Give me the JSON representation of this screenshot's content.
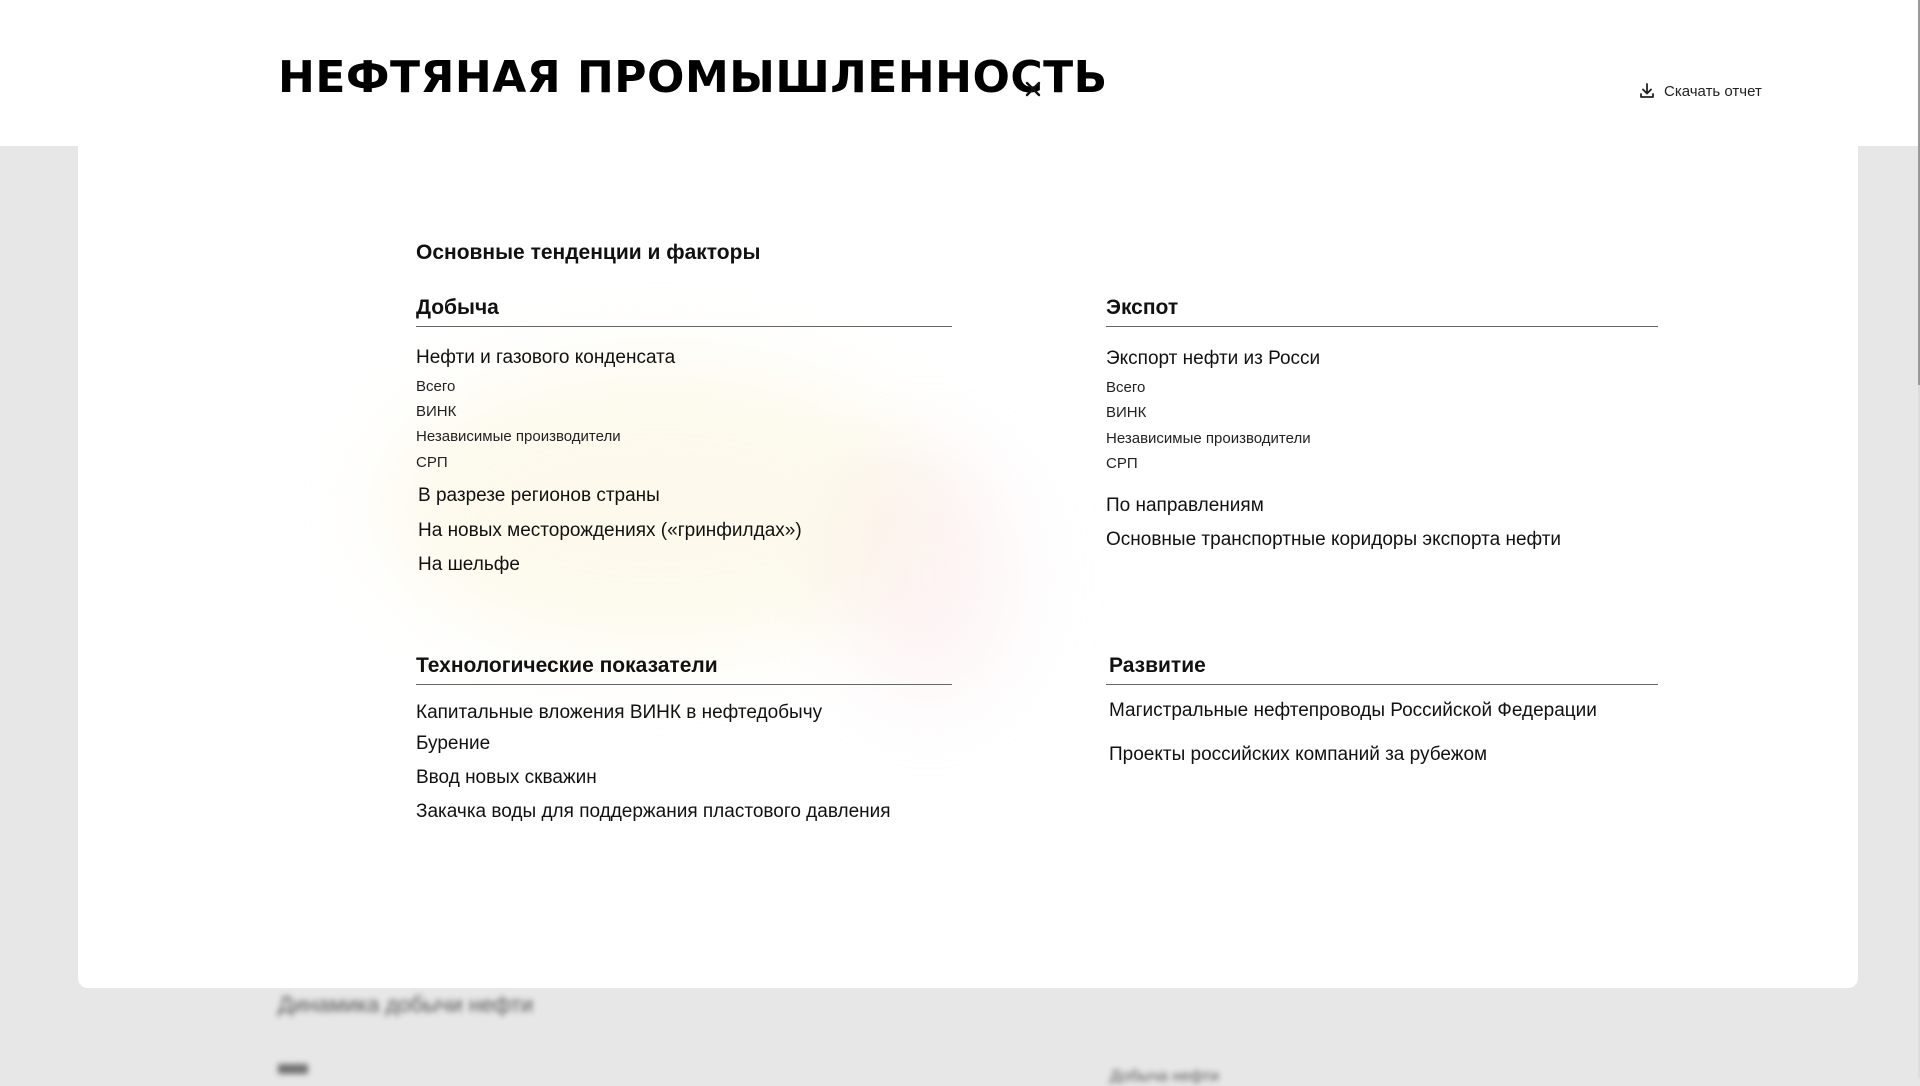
{
  "header": {
    "title": "НЕФТЯНАЯ ПРОМЫШЛЕННОСТЬ",
    "download_label": "Скачать отчет"
  },
  "main": {
    "section_title": "Основные тенденции и факторы",
    "extraction": {
      "title": "Добыча",
      "subheading": "Нефти и газового конденсата",
      "sub_items": [
        "Всего",
        "ВИНК",
        "Независимые производители",
        "СРП"
      ],
      "links": [
        "В разрезе регионов страны",
        "На новых месторождениях («гринфилдах»)",
        "На шельфе"
      ]
    },
    "export": {
      "title": "Экспот",
      "subheading": "Экспорт нефти из Росси",
      "sub_items": [
        "Всего",
        "ВИНК",
        "Независимые производители",
        "СРП"
      ],
      "links": [
        "По направлениям",
        "Основные транспортные коридоры экспорта нефти"
      ]
    },
    "tech": {
      "title": "Технологические показатели",
      "items": [
        "Капитальные вложения ВИНК в нефтедобычу",
        "Бурение",
        "Ввод новых скважин",
        "Закачка воды для поддержания пластового давления"
      ]
    },
    "development": {
      "title": "Развитие",
      "items": [
        "Магистральные нефтепроводы Российской Федерации",
        "Проекты российских компаний за рубежом"
      ]
    }
  },
  "background": {
    "blurred_line_1": "Динамика добычи нефти",
    "blurred_line_2": "Добыча нефти"
  },
  "colors": {
    "overlay": "#e7e7e7",
    "panel": "#ffffff",
    "text": "#111111"
  }
}
